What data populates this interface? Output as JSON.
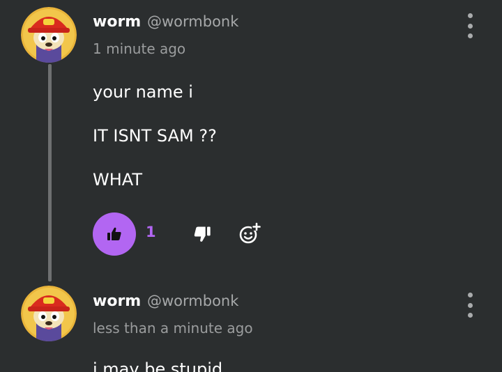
{
  "comments": [
    {
      "username": "worm",
      "handle": "@wormbonk",
      "timestamp": "1 minute ago",
      "lines": [
        "your name i",
        "IT ISNT SAM ??",
        "WHAT"
      ],
      "likes": "1"
    },
    {
      "username": "worm",
      "handle": "@wormbonk",
      "timestamp": "less than a minute ago",
      "lines": [
        "i may be stupid"
      ]
    }
  ],
  "colors": {
    "background": "#2b2e2f",
    "accent": "#b266f2",
    "muted_text": "#9b9d9e"
  },
  "icons": [
    "more-vertical-icon",
    "thumbs-up-icon",
    "thumbs-down-icon",
    "add-reaction-icon"
  ]
}
